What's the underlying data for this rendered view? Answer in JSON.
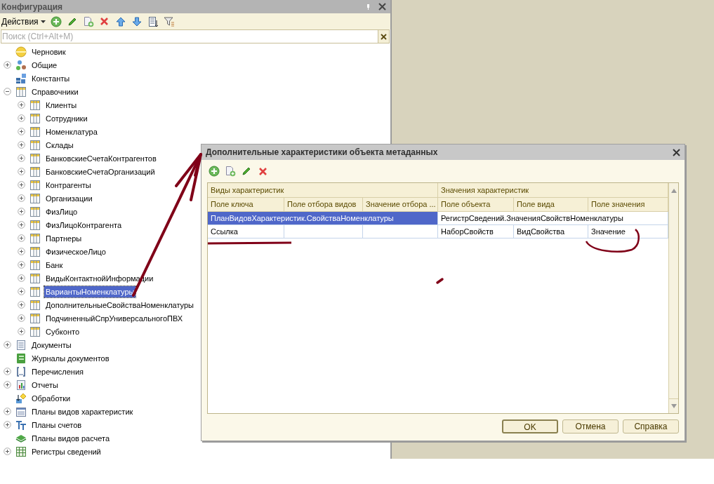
{
  "panel": {
    "title": "Конфигурация",
    "actions_label": "Действия",
    "search": {
      "placeholder": "Поиск (Ctrl+Alt+M)"
    }
  },
  "tree": [
    {
      "label": "Черновик",
      "kind": "circle",
      "selected": false
    },
    {
      "label": "Общие",
      "kind": "common",
      "expanded": false,
      "selected": false
    },
    {
      "label": "Константы",
      "kind": "constants",
      "selected": false
    },
    {
      "label": "Справочники",
      "kind": "catalog",
      "expanded": true,
      "selected": false,
      "children": [
        {
          "label": "Клиенты",
          "kind": "catalog",
          "expanded": false,
          "selected": false
        },
        {
          "label": "Сотрудники",
          "kind": "catalog",
          "expanded": false,
          "selected": false
        },
        {
          "label": "Номенклатура",
          "kind": "catalog",
          "expanded": false,
          "selected": false
        },
        {
          "label": "Склады",
          "kind": "catalog",
          "expanded": false,
          "selected": false
        },
        {
          "label": "БанковскиеСчетаКонтрагентов",
          "kind": "catalog",
          "expanded": false,
          "selected": false
        },
        {
          "label": "БанковскиеСчетаОрганизаций",
          "kind": "catalog",
          "expanded": false,
          "selected": false
        },
        {
          "label": "Контрагенты",
          "kind": "catalog",
          "expanded": false,
          "selected": false
        },
        {
          "label": "Организации",
          "kind": "catalog",
          "expanded": false,
          "selected": false
        },
        {
          "label": "ФизЛицо",
          "kind": "catalog",
          "expanded": false,
          "selected": false
        },
        {
          "label": "ФизЛицоКонтрагента",
          "kind": "catalog",
          "expanded": false,
          "selected": false
        },
        {
          "label": "Партнеры",
          "kind": "catalog",
          "expanded": false,
          "selected": false
        },
        {
          "label": "ФизическоеЛицо",
          "kind": "catalog",
          "expanded": false,
          "selected": false
        },
        {
          "label": "Банк",
          "kind": "catalog",
          "expanded": false,
          "selected": false
        },
        {
          "label": "ВидыКонтактнойИнформации",
          "kind": "catalog",
          "expanded": false,
          "selected": false
        },
        {
          "label": "ВариантыНоменклатуры",
          "kind": "catalog",
          "expanded": false,
          "selected": true
        },
        {
          "label": "ДополнительныеСвойстваНоменклатуры",
          "kind": "catalog",
          "expanded": false,
          "selected": false
        },
        {
          "label": "ПодчиненныйСпрУниверсальногоПВХ",
          "kind": "catalog",
          "expanded": false,
          "selected": false
        },
        {
          "label": "Субконто",
          "kind": "catalog",
          "expanded": false,
          "selected": false
        }
      ]
    },
    {
      "label": "Документы",
      "kind": "document",
      "expanded": false,
      "selected": false
    },
    {
      "label": "Журналы документов",
      "kind": "journal",
      "selected": false
    },
    {
      "label": "Перечисления",
      "kind": "enum",
      "expanded": false,
      "selected": false
    },
    {
      "label": "Отчеты",
      "kind": "report",
      "expanded": false,
      "selected": false
    },
    {
      "label": "Обработки",
      "kind": "processing",
      "selected": false
    },
    {
      "label": "Планы видов характеристик",
      "kind": "chart-plan",
      "expanded": false,
      "selected": false
    },
    {
      "label": "Планы счетов",
      "kind": "accounts",
      "expanded": false,
      "selected": false
    },
    {
      "label": "Планы видов расчета",
      "kind": "calc-plan",
      "selected": false
    },
    {
      "label": "Регистры сведений",
      "kind": "register",
      "expanded": false,
      "selected": false
    }
  ],
  "dialog": {
    "title": "Дополнительные характеристики объекта метаданных",
    "table": {
      "groups": [
        "Виды характеристик",
        "Значения характеристик"
      ],
      "columns": [
        "Поле ключа",
        "Поле отбора видов",
        "Значение отбора ...",
        "Поле объекта",
        "Поле вида",
        "Поле значения"
      ],
      "rows": [
        {
          "selected": true,
          "merged": true,
          "cells": [
            "ПланВидовХарактеристик.СвойстваНоменклатуры",
            null,
            null,
            "РегистрСведений.ЗначенияСвойствНоменклатуры",
            null,
            null
          ]
        },
        {
          "selected": false,
          "merged": false,
          "cells": [
            "Ссылка",
            null,
            null,
            "НаборСвойств",
            "ВидСвойства",
            "Значение"
          ]
        }
      ]
    },
    "buttons": [
      {
        "label": "OK",
        "focused": true
      },
      {
        "label": "Отмена",
        "focused": false
      },
      {
        "label": "Справка",
        "focused": false
      }
    ]
  }
}
